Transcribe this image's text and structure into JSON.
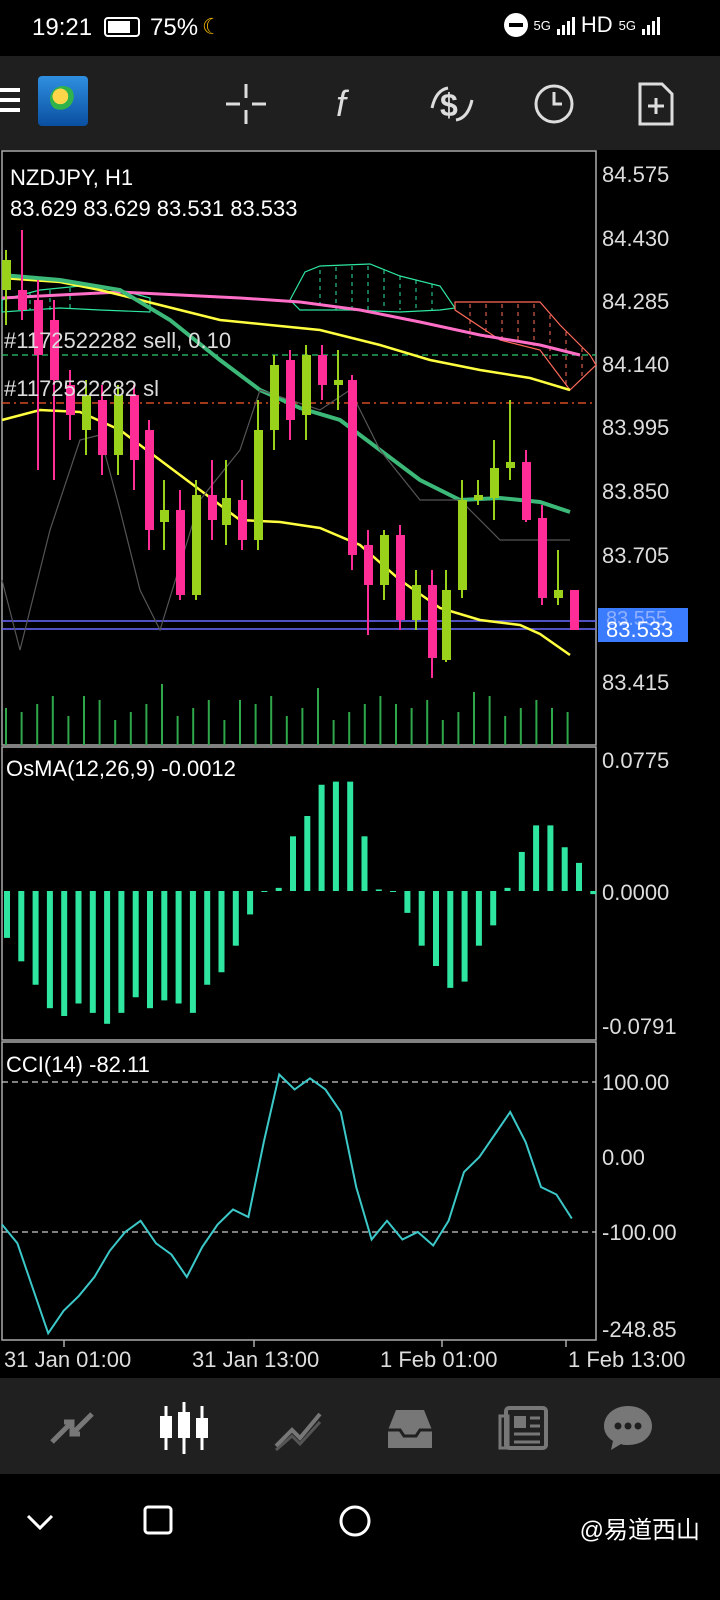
{
  "status_bar": {
    "time": "19:21",
    "battery": "75%",
    "network": "5G",
    "hd": "HD",
    "network2": "5G"
  },
  "toolbar": {
    "icons": [
      "menu-icon",
      "metatrader-logo",
      "crosshair-icon",
      "indicators-icon",
      "trade-icon",
      "timeframe-icon",
      "new-order-icon"
    ]
  },
  "chart": {
    "symbol": "NZDJPY, H1",
    "ohlc": "83.629 83.629 83.531 83.533",
    "price_labels": [
      "84.575",
      "84.430",
      "84.285",
      "84.140",
      "83.995",
      "83.850",
      "83.705",
      "83.415"
    ],
    "current_price": "83.533",
    "hidden_price": "83.555",
    "order_label_1": "#1172522282 sell, 0.10",
    "order_label_2": "#1172522282 sl",
    "osma": {
      "label": "OsMA(12,26,9) -0.0012",
      "top": "0.0775",
      "zero": "0.0000",
      "bottom": "-0.0791",
      "values": [
        -0.03,
        -0.045,
        -0.06,
        -0.075,
        -0.08,
        -0.072,
        -0.078,
        -0.085,
        -0.078,
        -0.068,
        -0.075,
        -0.07,
        -0.072,
        -0.078,
        -0.06,
        -0.052,
        -0.035,
        -0.015,
        0.0,
        0.002,
        0.035,
        0.048,
        0.068,
        0.07,
        0.07,
        0.035,
        0.001,
        0.0,
        -0.014,
        -0.035,
        -0.048,
        -0.062,
        -0.058,
        -0.035,
        -0.022,
        0.002,
        0.025,
        0.042,
        0.042,
        0.028,
        0.018,
        -0.002
      ]
    },
    "cci": {
      "label": "CCI(14) -82.11",
      "levels": [
        "100.00",
        "0.00",
        "-100.00",
        "-248.85"
      ],
      "values": [
        -90,
        -115,
        -175,
        -235,
        -205,
        -185,
        -160,
        -125,
        -100,
        -85,
        -115,
        -130,
        -160,
        -120,
        -90,
        -70,
        -80,
        20,
        110,
        90,
        105,
        90,
        60,
        -40,
        -110,
        -85,
        -110,
        -100,
        -118,
        -85,
        -20,
        0,
        30,
        60,
        20,
        -40,
        -50,
        -82
      ]
    },
    "time_labels": [
      "31 Jan 01:00",
      "31 Jan 13:00",
      "1 Feb 01:00",
      "1 Feb 13:00"
    ],
    "colors": {
      "bull": "#9ad21b",
      "bear": "#ff2d95",
      "osma": "#2ee6a0",
      "cci": "#3cc8c8",
      "ma_yellow": "#ffff40",
      "ma_green": "#3cb878",
      "ma_pink": "#ff6ec7",
      "cloud": "#2ee6a0",
      "cloud_bear": "#ff6a5a",
      "price_tag": "#3b7cff"
    }
  },
  "bottom_nav": {
    "items": [
      "quotes-icon",
      "chart-icon",
      "trade-icon",
      "history-icon",
      "news-icon",
      "chat-icon"
    ]
  },
  "system_nav": {
    "watermark": "@易道西山"
  }
}
